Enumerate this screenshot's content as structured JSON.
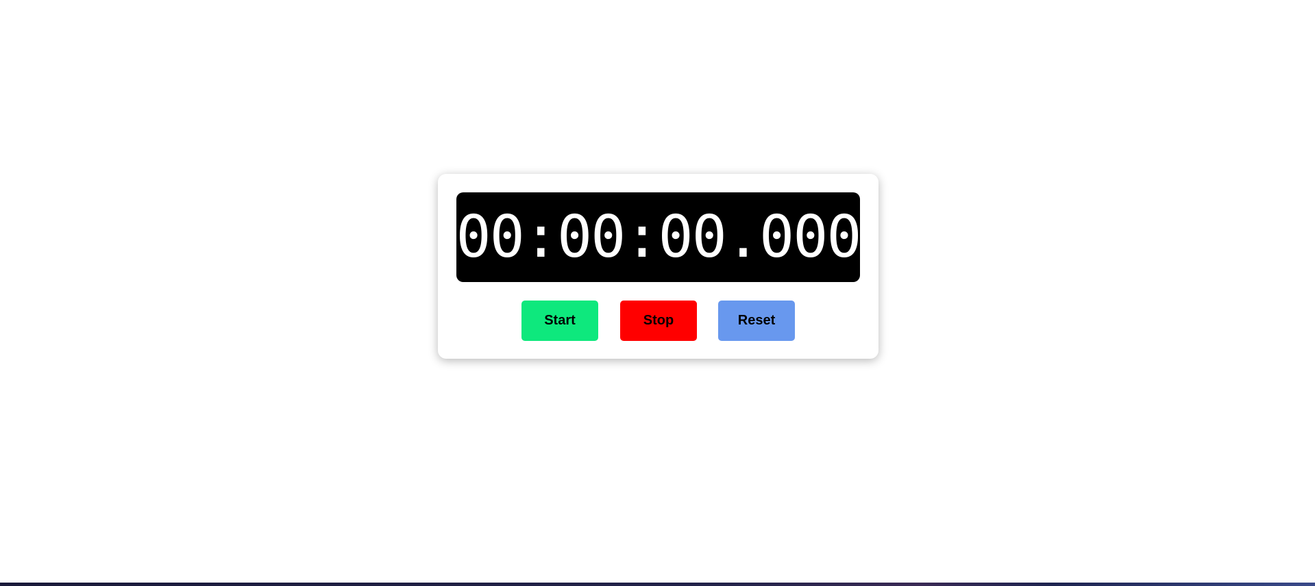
{
  "stopwatch": {
    "display": "00:00:00.000",
    "buttons": {
      "start_label": "Start",
      "stop_label": "Stop",
      "reset_label": "Reset"
    },
    "colors": {
      "display_bg": "#000000",
      "display_text": "#ffffff",
      "start": "#0ee87d",
      "stop": "#ff0000",
      "reset": "#6898ee"
    }
  }
}
